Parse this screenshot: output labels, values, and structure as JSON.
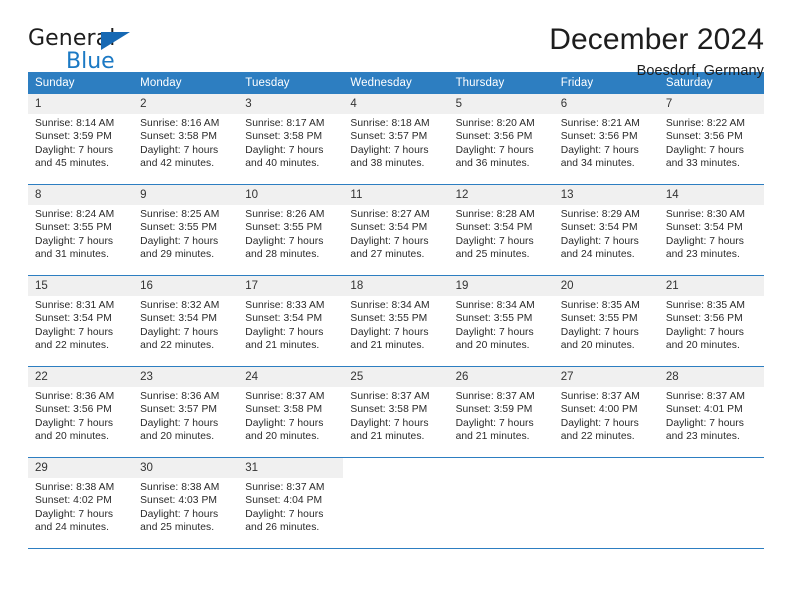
{
  "brand": {
    "name_top": "General",
    "name_bottom": "Blue",
    "accent_color": "#1b79c4",
    "triangle_color": "#1668b3"
  },
  "header": {
    "title": "December 2024",
    "subtitle": "Boesdorf, Germany"
  },
  "calendar": {
    "header_bg": "#2d7ec1",
    "daynum_bg": "#f0f0f0",
    "weekdays": [
      "Sunday",
      "Monday",
      "Tuesday",
      "Wednesday",
      "Thursday",
      "Friday",
      "Saturday"
    ],
    "weeks": [
      [
        {
          "day": "1",
          "sunrise": "Sunrise: 8:14 AM",
          "sunset": "Sunset: 3:59 PM",
          "daylight1": "Daylight: 7 hours",
          "daylight2": "and 45 minutes."
        },
        {
          "day": "2",
          "sunrise": "Sunrise: 8:16 AM",
          "sunset": "Sunset: 3:58 PM",
          "daylight1": "Daylight: 7 hours",
          "daylight2": "and 42 minutes."
        },
        {
          "day": "3",
          "sunrise": "Sunrise: 8:17 AM",
          "sunset": "Sunset: 3:58 PM",
          "daylight1": "Daylight: 7 hours",
          "daylight2": "and 40 minutes."
        },
        {
          "day": "4",
          "sunrise": "Sunrise: 8:18 AM",
          "sunset": "Sunset: 3:57 PM",
          "daylight1": "Daylight: 7 hours",
          "daylight2": "and 38 minutes."
        },
        {
          "day": "5",
          "sunrise": "Sunrise: 8:20 AM",
          "sunset": "Sunset: 3:56 PM",
          "daylight1": "Daylight: 7 hours",
          "daylight2": "and 36 minutes."
        },
        {
          "day": "6",
          "sunrise": "Sunrise: 8:21 AM",
          "sunset": "Sunset: 3:56 PM",
          "daylight1": "Daylight: 7 hours",
          "daylight2": "and 34 minutes."
        },
        {
          "day": "7",
          "sunrise": "Sunrise: 8:22 AM",
          "sunset": "Sunset: 3:56 PM",
          "daylight1": "Daylight: 7 hours",
          "daylight2": "and 33 minutes."
        }
      ],
      [
        {
          "day": "8",
          "sunrise": "Sunrise: 8:24 AM",
          "sunset": "Sunset: 3:55 PM",
          "daylight1": "Daylight: 7 hours",
          "daylight2": "and 31 minutes."
        },
        {
          "day": "9",
          "sunrise": "Sunrise: 8:25 AM",
          "sunset": "Sunset: 3:55 PM",
          "daylight1": "Daylight: 7 hours",
          "daylight2": "and 29 minutes."
        },
        {
          "day": "10",
          "sunrise": "Sunrise: 8:26 AM",
          "sunset": "Sunset: 3:55 PM",
          "daylight1": "Daylight: 7 hours",
          "daylight2": "and 28 minutes."
        },
        {
          "day": "11",
          "sunrise": "Sunrise: 8:27 AM",
          "sunset": "Sunset: 3:54 PM",
          "daylight1": "Daylight: 7 hours",
          "daylight2": "and 27 minutes."
        },
        {
          "day": "12",
          "sunrise": "Sunrise: 8:28 AM",
          "sunset": "Sunset: 3:54 PM",
          "daylight1": "Daylight: 7 hours",
          "daylight2": "and 25 minutes."
        },
        {
          "day": "13",
          "sunrise": "Sunrise: 8:29 AM",
          "sunset": "Sunset: 3:54 PM",
          "daylight1": "Daylight: 7 hours",
          "daylight2": "and 24 minutes."
        },
        {
          "day": "14",
          "sunrise": "Sunrise: 8:30 AM",
          "sunset": "Sunset: 3:54 PM",
          "daylight1": "Daylight: 7 hours",
          "daylight2": "and 23 minutes."
        }
      ],
      [
        {
          "day": "15",
          "sunrise": "Sunrise: 8:31 AM",
          "sunset": "Sunset: 3:54 PM",
          "daylight1": "Daylight: 7 hours",
          "daylight2": "and 22 minutes."
        },
        {
          "day": "16",
          "sunrise": "Sunrise: 8:32 AM",
          "sunset": "Sunset: 3:54 PM",
          "daylight1": "Daylight: 7 hours",
          "daylight2": "and 22 minutes."
        },
        {
          "day": "17",
          "sunrise": "Sunrise: 8:33 AM",
          "sunset": "Sunset: 3:54 PM",
          "daylight1": "Daylight: 7 hours",
          "daylight2": "and 21 minutes."
        },
        {
          "day": "18",
          "sunrise": "Sunrise: 8:34 AM",
          "sunset": "Sunset: 3:55 PM",
          "daylight1": "Daylight: 7 hours",
          "daylight2": "and 21 minutes."
        },
        {
          "day": "19",
          "sunrise": "Sunrise: 8:34 AM",
          "sunset": "Sunset: 3:55 PM",
          "daylight1": "Daylight: 7 hours",
          "daylight2": "and 20 minutes."
        },
        {
          "day": "20",
          "sunrise": "Sunrise: 8:35 AM",
          "sunset": "Sunset: 3:55 PM",
          "daylight1": "Daylight: 7 hours",
          "daylight2": "and 20 minutes."
        },
        {
          "day": "21",
          "sunrise": "Sunrise: 8:35 AM",
          "sunset": "Sunset: 3:56 PM",
          "daylight1": "Daylight: 7 hours",
          "daylight2": "and 20 minutes."
        }
      ],
      [
        {
          "day": "22",
          "sunrise": "Sunrise: 8:36 AM",
          "sunset": "Sunset: 3:56 PM",
          "daylight1": "Daylight: 7 hours",
          "daylight2": "and 20 minutes."
        },
        {
          "day": "23",
          "sunrise": "Sunrise: 8:36 AM",
          "sunset": "Sunset: 3:57 PM",
          "daylight1": "Daylight: 7 hours",
          "daylight2": "and 20 minutes."
        },
        {
          "day": "24",
          "sunrise": "Sunrise: 8:37 AM",
          "sunset": "Sunset: 3:58 PM",
          "daylight1": "Daylight: 7 hours",
          "daylight2": "and 20 minutes."
        },
        {
          "day": "25",
          "sunrise": "Sunrise: 8:37 AM",
          "sunset": "Sunset: 3:58 PM",
          "daylight1": "Daylight: 7 hours",
          "daylight2": "and 21 minutes."
        },
        {
          "day": "26",
          "sunrise": "Sunrise: 8:37 AM",
          "sunset": "Sunset: 3:59 PM",
          "daylight1": "Daylight: 7 hours",
          "daylight2": "and 21 minutes."
        },
        {
          "day": "27",
          "sunrise": "Sunrise: 8:37 AM",
          "sunset": "Sunset: 4:00 PM",
          "daylight1": "Daylight: 7 hours",
          "daylight2": "and 22 minutes."
        },
        {
          "day": "28",
          "sunrise": "Sunrise: 8:37 AM",
          "sunset": "Sunset: 4:01 PM",
          "daylight1": "Daylight: 7 hours",
          "daylight2": "and 23 minutes."
        }
      ],
      [
        {
          "day": "29",
          "sunrise": "Sunrise: 8:38 AM",
          "sunset": "Sunset: 4:02 PM",
          "daylight1": "Daylight: 7 hours",
          "daylight2": "and 24 minutes."
        },
        {
          "day": "30",
          "sunrise": "Sunrise: 8:38 AM",
          "sunset": "Sunset: 4:03 PM",
          "daylight1": "Daylight: 7 hours",
          "daylight2": "and 25 minutes."
        },
        {
          "day": "31",
          "sunrise": "Sunrise: 8:37 AM",
          "sunset": "Sunset: 4:04 PM",
          "daylight1": "Daylight: 7 hours",
          "daylight2": "and 26 minutes."
        },
        {
          "day": "",
          "sunrise": "",
          "sunset": "",
          "daylight1": "",
          "daylight2": ""
        },
        {
          "day": "",
          "sunrise": "",
          "sunset": "",
          "daylight1": "",
          "daylight2": ""
        },
        {
          "day": "",
          "sunrise": "",
          "sunset": "",
          "daylight1": "",
          "daylight2": ""
        },
        {
          "day": "",
          "sunrise": "",
          "sunset": "",
          "daylight1": "",
          "daylight2": ""
        }
      ]
    ]
  }
}
